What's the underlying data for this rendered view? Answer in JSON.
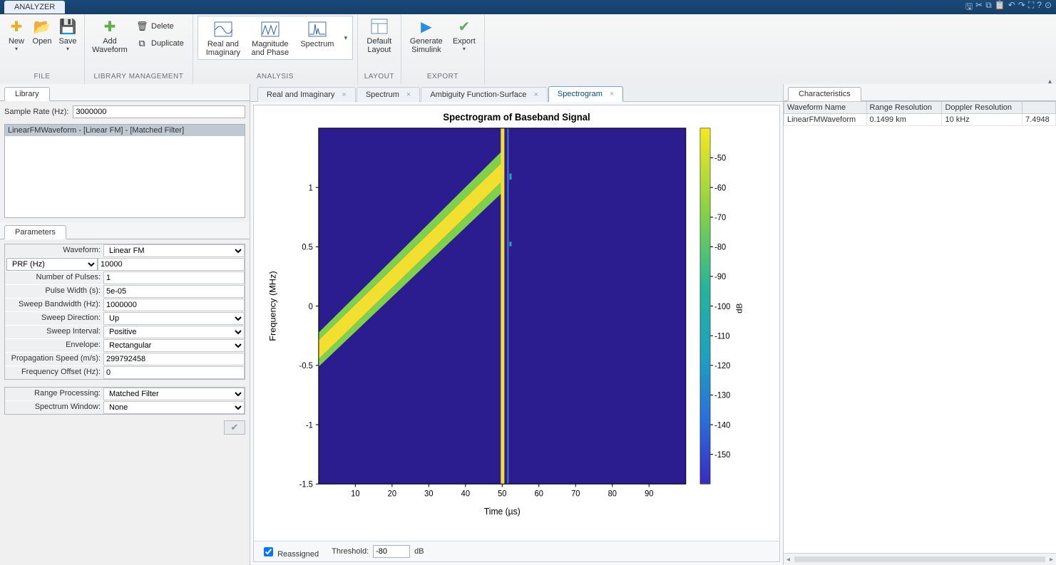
{
  "app": {
    "tab_title": "ANALYZER"
  },
  "ribbon": {
    "file": {
      "group": "FILE",
      "new": "New",
      "open": "Open",
      "save": "Save"
    },
    "lib": {
      "group": "LIBRARY MANAGEMENT",
      "add": "Add\nWaveform",
      "delete": "Delete",
      "duplicate": "Duplicate"
    },
    "analysis": {
      "group": "ANALYSIS",
      "real_imag": "Real and\nImaginary",
      "mag_phase": "Magnitude\nand Phase",
      "spectrum": "Spectrum"
    },
    "layout": {
      "group": "LAYOUT",
      "default": "Default\nLayout"
    },
    "export": {
      "group": "EXPORT",
      "gensim": "Generate\nSimulink",
      "export": "Export"
    }
  },
  "library": {
    "tab": "Library",
    "sample_rate_label": "Sample Rate (Hz):",
    "sample_rate": "3000000",
    "items": [
      "LinearFMWaveform - [Linear FM] - [Matched Filter]"
    ]
  },
  "parameters": {
    "tab": "Parameters",
    "rows": [
      {
        "label": "Waveform:",
        "value": "Linear FM",
        "type": "select"
      },
      {
        "label": "PRF (Hz)",
        "value": "10000",
        "type": "combo"
      },
      {
        "label": "Number of Pulses:",
        "value": "1",
        "type": "text"
      },
      {
        "label": "Pulse Width (s):",
        "value": "5e-05",
        "type": "text"
      },
      {
        "label": "Sweep Bandwidth (Hz):",
        "value": "1000000",
        "type": "text"
      },
      {
        "label": "Sweep Direction:",
        "value": "Up",
        "type": "select"
      },
      {
        "label": "Sweep Interval:",
        "value": "Positive",
        "type": "select"
      },
      {
        "label": "Envelope:",
        "value": "Rectangular",
        "type": "select"
      },
      {
        "label": "Propagation Speed (m/s):",
        "value": "299792458",
        "type": "text"
      },
      {
        "label": "Frequency Offset (Hz):",
        "value": "0",
        "type": "text"
      }
    ],
    "rows2": [
      {
        "label": "Range Processing:",
        "value": "Matched Filter",
        "type": "select"
      },
      {
        "label": "Spectrum Window:",
        "value": "None",
        "type": "select"
      }
    ]
  },
  "doc_tabs": [
    {
      "label": "Real and Imaginary",
      "active": false
    },
    {
      "label": "Spectrum",
      "active": false
    },
    {
      "label": "Ambiguity Function-Surface",
      "active": false
    },
    {
      "label": "Spectrogram",
      "active": true
    }
  ],
  "plot": {
    "title": "Spectrogram of Baseband Signal",
    "xlabel": "Time (µs)",
    "ylabel": "Frequency (MHz)",
    "clabel": "dB",
    "xticks": [
      10,
      20,
      30,
      40,
      50,
      60,
      70,
      80,
      90
    ],
    "yticks": [
      -1.5,
      -1,
      -0.5,
      0,
      0.5,
      1
    ],
    "cticks": [
      -50,
      -60,
      -70,
      -80,
      -90,
      -100,
      -110,
      -120,
      -130,
      -140,
      -150
    ],
    "reassigned_label": "Reassigned",
    "threshold_label": "Threshold:",
    "threshold": "-80",
    "threshold_unit": "dB"
  },
  "characteristics": {
    "tab": "Characteristics",
    "headers": [
      "Waveform Name",
      "Range Resolution",
      "Doppler Resolution",
      ""
    ],
    "row": [
      "LinearFMWaveform",
      "0.1499 km",
      "10 kHz",
      "7.4948"
    ]
  },
  "chart_data": {
    "type": "heatmap",
    "title": "Spectrogram of Baseband Signal",
    "xlabel": "Time (µs)",
    "ylabel": "Frequency (MHz)",
    "clabel": "dB",
    "xlim": [
      0,
      100
    ],
    "ylim": [
      -1.5,
      1.5
    ],
    "clim": [
      -160,
      -40
    ],
    "description": "Linear FM chirp sweeping from ~0 MHz at 0 µs to ~1 MHz at 50 µs; bright vertical line at 50 µs; background near -160 dB",
    "chirp": {
      "t_start": 0,
      "f_start": 0,
      "t_end": 50,
      "f_end": 1,
      "peak_db": -40,
      "width_MHz": 0.15
    },
    "pulse_edge_us": 50
  }
}
